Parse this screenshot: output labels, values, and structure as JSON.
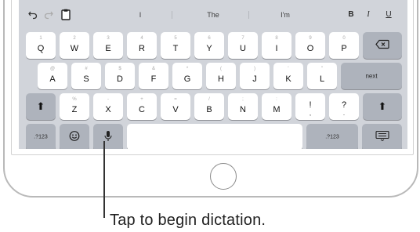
{
  "shortcut_bar": {
    "undo_icon": "undo-arrow-icon",
    "redo_icon": "redo-arrow-icon",
    "paste_icon": "clipboard-icon",
    "suggestions": [
      "I",
      "The",
      "I'm"
    ],
    "format": {
      "bold": "B",
      "italic": "I",
      "underline": "U"
    }
  },
  "keyboard": {
    "row1": [
      {
        "hint": "1",
        "key": "Q"
      },
      {
        "hint": "2",
        "key": "W"
      },
      {
        "hint": "3",
        "key": "E"
      },
      {
        "hint": "4",
        "key": "R"
      },
      {
        "hint": "5",
        "key": "T"
      },
      {
        "hint": "6",
        "key": "Y"
      },
      {
        "hint": "7",
        "key": "U"
      },
      {
        "hint": "8",
        "key": "I"
      },
      {
        "hint": "9",
        "key": "O"
      },
      {
        "hint": "0",
        "key": "P"
      }
    ],
    "row2": [
      {
        "hint": "@",
        "key": "A"
      },
      {
        "hint": "#",
        "key": "S"
      },
      {
        "hint": "$",
        "key": "D"
      },
      {
        "hint": "&",
        "key": "F"
      },
      {
        "hint": "*",
        "key": "G"
      },
      {
        "hint": "(",
        "key": "H"
      },
      {
        "hint": ")",
        "key": "J"
      },
      {
        "hint": "'",
        "key": "K"
      },
      {
        "hint": "\"",
        "key": "L"
      }
    ],
    "row3": [
      {
        "hint": "%",
        "key": "Z"
      },
      {
        "hint": "-",
        "key": "X"
      },
      {
        "hint": "+",
        "key": "C"
      },
      {
        "hint": "=",
        "key": "V"
      },
      {
        "hint": "/",
        "key": "B"
      },
      {
        "hint": ";",
        "key": "N"
      },
      {
        "hint": ":",
        "key": "M"
      },
      {
        "hint": "",
        "key": "!"
      },
      {
        "hint": "",
        "key": "?"
      }
    ],
    "return_label": "next",
    "numbers_label": ".?123",
    "numbers_label_right": ".?123",
    "shift_glyph": "⬆",
    "delete_glyph": "⌫",
    "emoji_glyph": "☺",
    "mic_glyph": "🎙",
    "hide_keyboard_glyph": "⌨"
  },
  "caption": "Tap to begin dictation."
}
